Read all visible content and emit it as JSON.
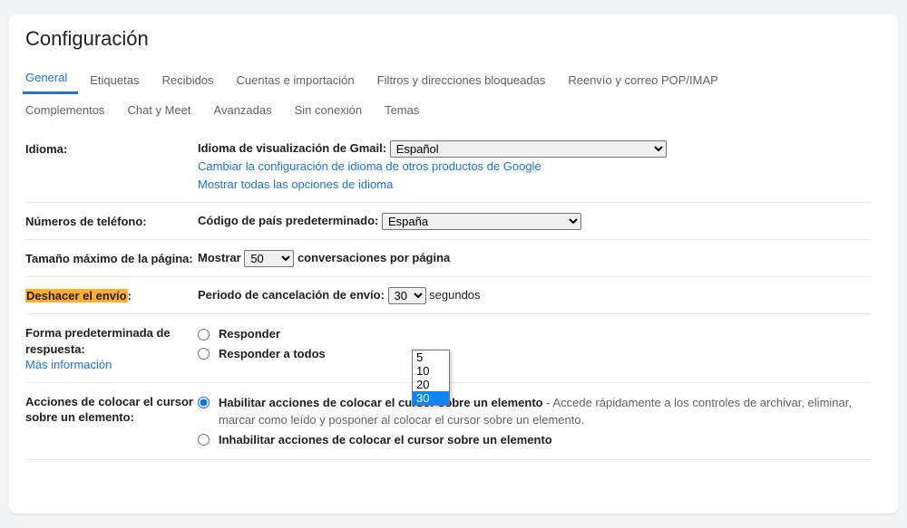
{
  "title": "Configuración",
  "tabs_row1": [
    {
      "label": "General",
      "active": true
    },
    {
      "label": "Etiquetas"
    },
    {
      "label": "Recibidos"
    },
    {
      "label": "Cuentas e importación"
    },
    {
      "label": "Filtros y direcciones bloqueadas"
    },
    {
      "label": "Reenvío y correo POP/IMAP"
    }
  ],
  "tabs_row2": [
    {
      "label": "Complementos"
    },
    {
      "label": "Chat y Meet"
    },
    {
      "label": "Avanzadas"
    },
    {
      "label": "Sin conexión"
    },
    {
      "label": "Temas"
    }
  ],
  "idioma": {
    "label": "Idioma:",
    "display_label": "Idioma de visualización de Gmail:",
    "value": "Español",
    "link1": "Cambiar la configuración de idioma de otros productos de Google",
    "link2": "Mostrar todas las opciones de idioma"
  },
  "telefono": {
    "label": "Números de teléfono:",
    "code_label": "Código de país predeterminado:",
    "value": "España"
  },
  "pagesize": {
    "label": "Tamaño máximo de la página:",
    "prefix": "Mostrar",
    "value": "50",
    "suffix": "conversaciones por página"
  },
  "undo": {
    "label_pre": "Deshacer el envío",
    "label_post": ":",
    "period_label": "Periodo de cancelación de envío:",
    "value": "30",
    "suffix": "segundos",
    "options": [
      "5",
      "10",
      "20",
      "30"
    ]
  },
  "reply": {
    "label": "Forma predeterminada de respuesta:",
    "more": "Más información",
    "opt1": "Responder",
    "opt2": "Responder a todos"
  },
  "hover": {
    "label": "Acciones de colocar el cursor sobre un elemento:",
    "opt1_bold": "Habilitar acciones de colocar el cursor sobre un elemento",
    "opt1_desc": " - Accede rápidamente a los controles de archivar, eliminar, marcar como leído y posponer al colocar el cursor sobre un elemento.",
    "opt2_bold": "Inhabilitar acciones de colocar el cursor sobre un elemento"
  }
}
